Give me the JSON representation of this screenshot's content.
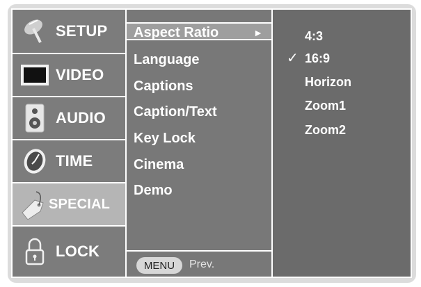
{
  "categories": [
    {
      "label": "SETUP",
      "icon": "satellite-dish-icon",
      "active": false
    },
    {
      "label": "VIDEO",
      "icon": "monitor-icon",
      "active": false
    },
    {
      "label": "AUDIO",
      "icon": "speaker-icon",
      "active": false
    },
    {
      "label": "TIME",
      "icon": "clock-icon",
      "active": false
    },
    {
      "label": "SPECIAL",
      "icon": "tag-icon",
      "active": true
    },
    {
      "label": "LOCK",
      "icon": "padlock-icon",
      "active": false
    }
  ],
  "submenu": {
    "items": [
      {
        "label": "Aspect Ratio",
        "highlighted": true
      },
      {
        "label": "Language"
      },
      {
        "label": "Captions"
      },
      {
        "label": "Caption/Text"
      },
      {
        "label": "Key Lock"
      },
      {
        "label": "Cinema"
      },
      {
        "label": "Demo"
      }
    ],
    "arrow": "►",
    "menu_button": "MENU",
    "prev_label": "Prev."
  },
  "options": {
    "items": [
      "4:3",
      "16:9",
      "Horizon",
      "Zoom1",
      "Zoom2"
    ],
    "selected": "16:9",
    "check_mark": "✓"
  },
  "colors": {
    "panel": "#6b6b6b",
    "active_category": "#b5b5b5",
    "highlight": "#9e9e9e",
    "text": "#ffffff"
  }
}
